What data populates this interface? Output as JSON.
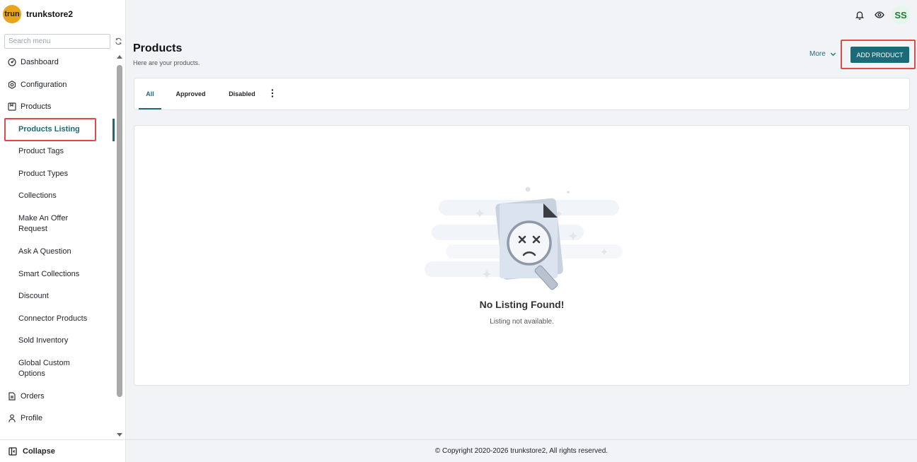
{
  "brand": {
    "logo_text": "trun",
    "store_name": "trunkstore2"
  },
  "search": {
    "placeholder": "Search menu"
  },
  "sidebar": {
    "items": [
      {
        "label": "Dashboard",
        "icon": "dashboard-icon"
      },
      {
        "label": "Configuration",
        "icon": "settings-icon"
      },
      {
        "label": "Products",
        "icon": "products-icon"
      },
      {
        "label": "Products Listing"
      },
      {
        "label": "Product Tags"
      },
      {
        "label": "Product Types"
      },
      {
        "label": "Collections"
      },
      {
        "label": "Make An Offer Request"
      },
      {
        "label": "Ask A Question"
      },
      {
        "label": "Smart Collections"
      },
      {
        "label": "Discount"
      },
      {
        "label": "Connector Products"
      },
      {
        "label": "Sold Inventory"
      },
      {
        "label": "Global Custom Options"
      },
      {
        "label": "Orders",
        "icon": "orders-icon"
      },
      {
        "label": "Profile",
        "icon": "profile-icon"
      }
    ],
    "active_item": "Products Listing",
    "collapse_label": "Collapse"
  },
  "topbar": {
    "avatar_initials": "SS",
    "icons": [
      "bell-icon",
      "eye-icon"
    ]
  },
  "header": {
    "title": "Products",
    "subtitle": "Here are your products.",
    "more_label": "More",
    "add_button_label": "ADD PRODUCT"
  },
  "tabs": [
    {
      "label": "All",
      "active": true
    },
    {
      "label": "Approved",
      "active": false
    },
    {
      "label": "Disabled",
      "active": false
    }
  ],
  "empty_state": {
    "title": "No Listing Found!",
    "message": "Listing not available."
  },
  "footer": {
    "copyright": "© Copyright 2020-2026 trunkstore2, All rights reserved."
  },
  "colors": {
    "accent": "#1c6a78",
    "highlight": "#e34848",
    "brand_logo": "#e8a41c"
  }
}
